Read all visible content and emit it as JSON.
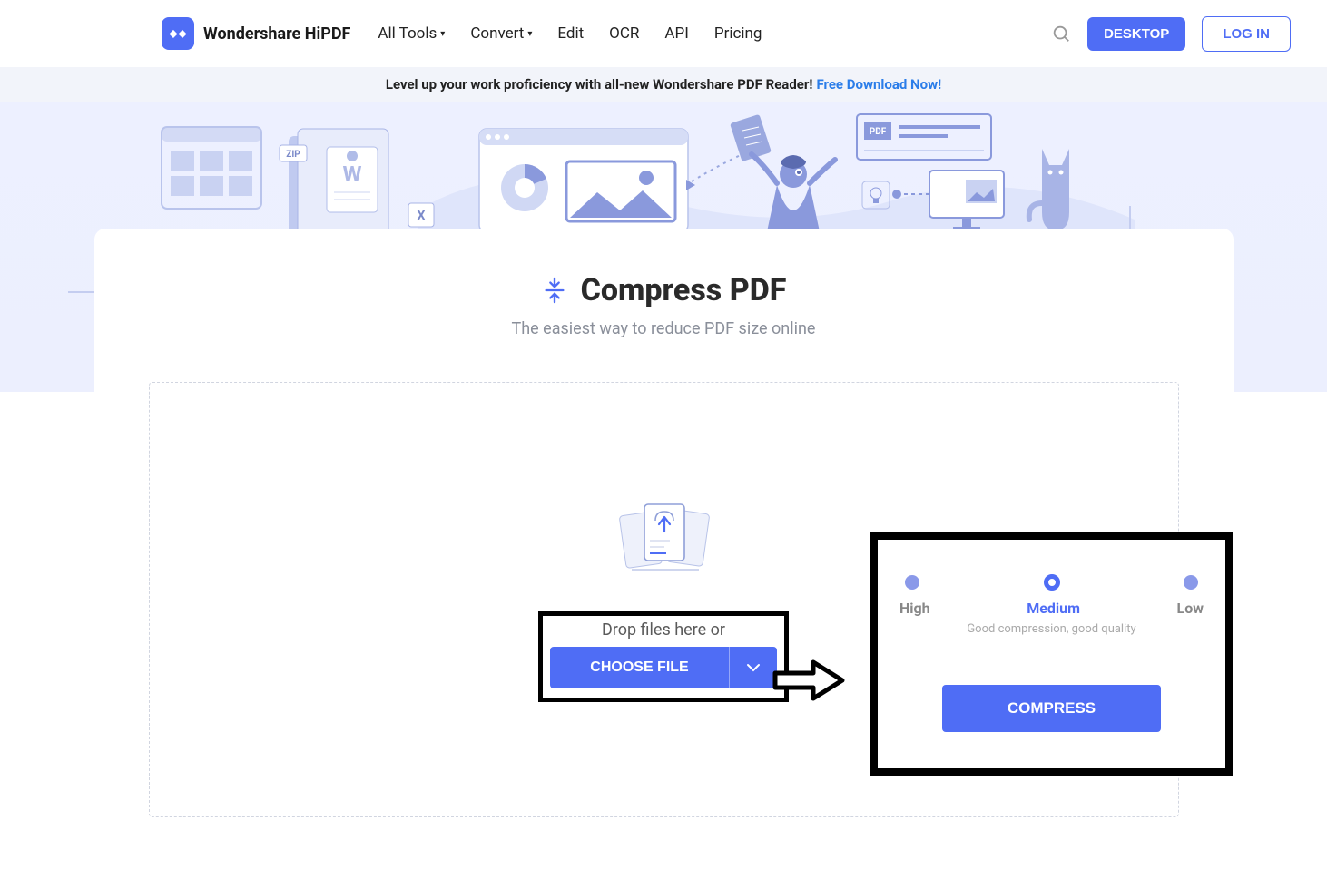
{
  "brand": {
    "name": "Wondershare HiPDF"
  },
  "nav": {
    "all_tools": "All Tools",
    "convert": "Convert",
    "edit": "Edit",
    "ocr": "OCR",
    "api": "API",
    "pricing": "Pricing"
  },
  "header": {
    "desktop": "DESKTOP",
    "login": "LOG IN"
  },
  "banner": {
    "text": "Level up your work proficiency with all-new Wondershare PDF Reader!",
    "link": "Free Download Now!"
  },
  "page": {
    "title": "Compress PDF",
    "subtitle": "The easiest way to reduce PDF size online"
  },
  "dropzone": {
    "hint": "Drop files here or",
    "choose": "CHOOSE FILE"
  },
  "compression": {
    "levels": {
      "high": "High",
      "medium": "Medium",
      "low": "Low"
    },
    "desc": "Good compression, good quality",
    "button": "COMPRESS"
  }
}
